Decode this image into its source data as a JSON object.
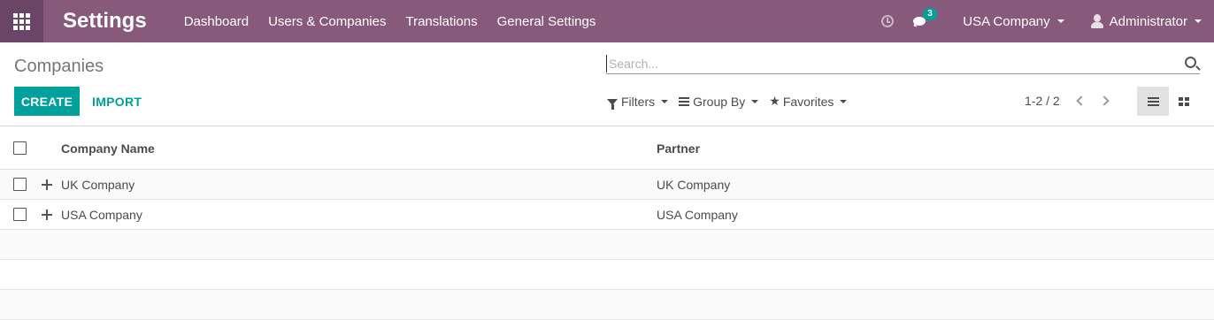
{
  "navbar": {
    "app_title": "Settings",
    "menu": [
      "Dashboard",
      "Users & Companies",
      "Translations",
      "General Settings"
    ],
    "chat_badge": "3",
    "company": "USA Company",
    "user": "Administrator",
    "colors": {
      "navbar": "#875a7b",
      "accent": "#00a09d"
    }
  },
  "control": {
    "breadcrumb": "Companies",
    "create_label": "CREATE",
    "import_label": "IMPORT",
    "search_placeholder": "Search...",
    "filters_label": "Filters",
    "groupby_label": "Group By",
    "favorites_label": "Favorites",
    "pager": "1-2 / 2"
  },
  "table": {
    "columns": [
      "Company Name",
      "Partner"
    ],
    "rows": [
      {
        "name": "UK Company",
        "partner": "UK Company"
      },
      {
        "name": "USA Company",
        "partner": "USA Company"
      }
    ]
  }
}
